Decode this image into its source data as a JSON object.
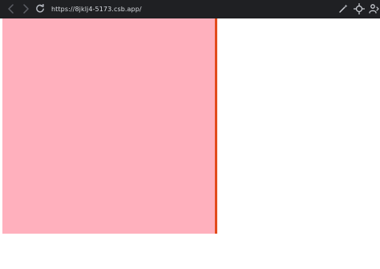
{
  "browser": {
    "url": "https://8jklj4-5173.csb.app/",
    "icons": {
      "back": "chevron-left-icon",
      "forward": "chevron-right-icon",
      "reload": "reload-icon",
      "wand": "magic-wand-icon",
      "target": "crosshair-icon",
      "person": "person-pin-icon"
    }
  },
  "page": {
    "panel_color": "#ffb0bd",
    "divider_color": "#e24b1b",
    "background_color": "#ffffff"
  }
}
